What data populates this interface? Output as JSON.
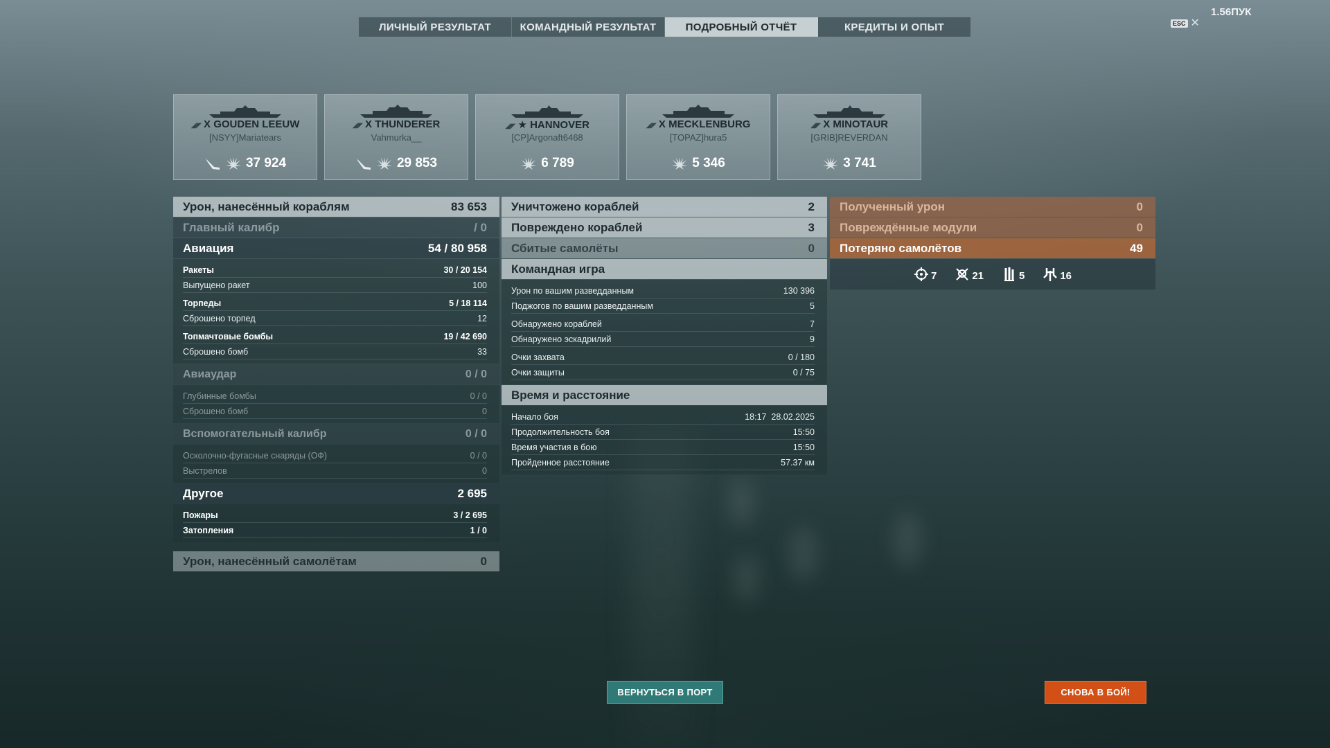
{
  "version": "1.56ПУК",
  "esc_key": "ESC",
  "tabs": [
    "ЛИЧНЫЙ РЕЗУЛЬТАТ",
    "КОМАНДНЫЙ РЕЗУЛЬТАТ",
    "ПОДРОБНЫЙ ОТЧЁТ",
    "КРЕДИТЫ И ОПЫТ"
  ],
  "active_tab": "ПОДРОБНЫЙ ОТЧЁТ",
  "team": [
    {
      "tier": "X",
      "ship": "GOUDEN LEEUW",
      "player": "[NSYY]Mariatears",
      "damage": "37 924"
    },
    {
      "tier": "X",
      "ship": "THUNDERER",
      "player": "Vahmurka__",
      "damage": "29 853"
    },
    {
      "tier": "★",
      "ship": "HANNOVER",
      "player": "[CP]Argonaft6468",
      "damage": "6 789"
    },
    {
      "tier": "X",
      "ship": "MECKLENBURG",
      "player": "[TOPAZ]hura5",
      "damage": "5 346"
    },
    {
      "tier": "X",
      "ship": "MINOTAUR",
      "player": "[GRIB]REVERDAN",
      "damage": "3 741"
    }
  ],
  "left": {
    "dmg_ships": {
      "label": "Урон, нанесённый кораблям",
      "value": "83 653"
    },
    "main_battery": {
      "label": "Главный калибр",
      "value": "/ 0"
    },
    "aviation": {
      "label": "Авиация",
      "value": "54 / 80 958"
    },
    "rockets": {
      "label": "Ракеты",
      "value": "30 / 20 154"
    },
    "rockets_fired": {
      "label": "Выпущено ракет",
      "value": "100"
    },
    "torpedoes": {
      "label": "Торпеды",
      "value": "5 / 18 114"
    },
    "torpedoes_dropped": {
      "label": "Сброшено торпед",
      "value": "12"
    },
    "skip_bombs": {
      "label": "Топмачтовые бомбы",
      "value": "19 / 42 690"
    },
    "bombs_dropped": {
      "label": "Сброшено бомб",
      "value": "33"
    },
    "airstrike": {
      "label": "Авиаудар",
      "value": "0 / 0"
    },
    "depth_charges": {
      "label": "Глубинные бомбы",
      "value": "0 / 0"
    },
    "depth_dropped": {
      "label": "Сброшено бомб",
      "value": "0"
    },
    "secondary": {
      "label": "Вспомогательный калибр",
      "value": "0 / 0"
    },
    "he_shells": {
      "label": "Осколочно-фугасные снаряды (ОФ)",
      "value": "0 / 0"
    },
    "shots": {
      "label": "Выстрелов",
      "value": "0"
    },
    "other": {
      "label": "Другое",
      "value": "2 695"
    },
    "fires": {
      "label": "Пожары",
      "value": "3 / 2 695"
    },
    "floods": {
      "label": "Затопления",
      "value": "1 / 0"
    },
    "dmg_planes": {
      "label": "Урон, нанесённый самолётам",
      "value": "0"
    }
  },
  "mid": {
    "destroyed": {
      "label": "Уничтожено кораблей",
      "value": "2"
    },
    "damaged": {
      "label": "Повреждено кораблей",
      "value": "3"
    },
    "planes_shot": {
      "label": "Сбитые самолёты",
      "value": "0"
    },
    "team_play": "Командная игра",
    "spot_dmg": {
      "label": "Урон по вашим разведданным",
      "value": "130 396"
    },
    "spot_fires": {
      "label": "Поджогов по вашим разведданным",
      "value": "5"
    },
    "ships_spotted": {
      "label": "Обнаружено кораблей",
      "value": "7"
    },
    "sq_spotted": {
      "label": "Обнаружено эскадрилий",
      "value": "9"
    },
    "cap_pts": {
      "label": "Очки захвата",
      "value": "0 / 180"
    },
    "def_pts": {
      "label": "Очки защиты",
      "value": "0 / 75"
    },
    "time_dist": "Время и расстояние",
    "start": {
      "label": "Начало боя",
      "value": "18:17  28.02.2025"
    },
    "duration": {
      "label": "Продолжительность боя",
      "value": "15:50"
    },
    "participation": {
      "label": "Время участия в бою",
      "value": "15:50"
    },
    "distance": {
      "label": "Пройденное расстояние",
      "value": "57.37 км"
    }
  },
  "right": {
    "received": {
      "label": "Полученный урон",
      "value": "0"
    },
    "modules": {
      "label": "Повреждённые модули",
      "value": "0"
    },
    "planes_lost": {
      "label": "Потеряно самолётов",
      "value": "49"
    },
    "plane_types": [
      {
        "icon": "attack-aircraft-icon",
        "count": "7"
      },
      {
        "icon": "torpedo-bomber-icon",
        "count": "21"
      },
      {
        "icon": "bomber-icon",
        "count": "5"
      },
      {
        "icon": "fighter-icon",
        "count": "16"
      }
    ]
  },
  "buttons": {
    "port": "ВЕРНУТЬСЯ В ПОРТ",
    "battle": "СНОВА В БОЙ!"
  }
}
